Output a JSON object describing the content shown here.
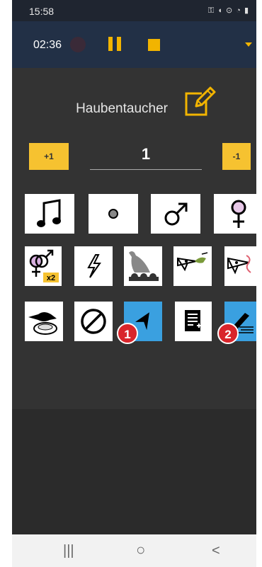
{
  "status_bar": {
    "time": "15:58",
    "icons": "⚿ ◖ ⊙ ◔ ▮"
  },
  "toolbar": {
    "timer": "02:36"
  },
  "species": {
    "name": "Haubentaucher"
  },
  "counter": {
    "plus_label": "+1",
    "minus_label": "-1",
    "value": "1"
  },
  "icon_grid": [
    [
      "music-note-icon",
      "dot-icon",
      "male-icon",
      "female-icon"
    ],
    [
      "pair-x2-icon",
      "lightning-icon",
      "duck-with-chicks-icon",
      "fish-in-beak-icon",
      "bird-with-worm-icon"
    ],
    [
      "bird-on-nest-icon",
      "prohibited-icon",
      "navigation-arrow-icon",
      "notes-icon",
      "pencil-icon"
    ]
  ],
  "badges": {
    "one": "1",
    "two": "2"
  },
  "colors": {
    "accent": "#f2b400",
    "active": "#3aa0e0",
    "badge": "#d9252b"
  },
  "nav": {
    "recent": "|||",
    "home": "○",
    "back": "<"
  }
}
